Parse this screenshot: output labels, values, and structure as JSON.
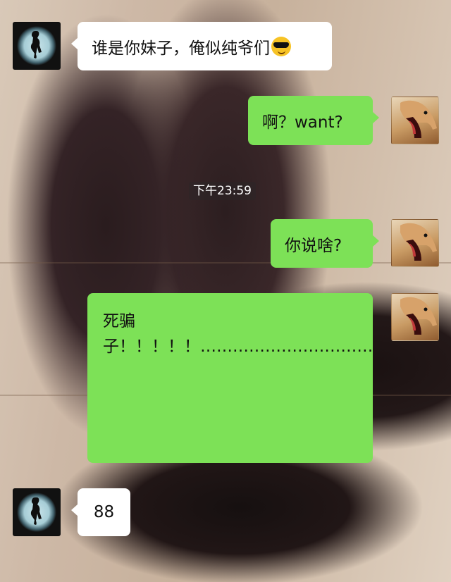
{
  "messages": [
    {
      "side": "left",
      "avatar": "silhouette-avatar",
      "text": "谁是你妹子，俺似纯爷们",
      "emoji": "cool-sunglasses-emoji"
    },
    {
      "side": "right",
      "avatar": "dog-avatar",
      "text": "啊？want?"
    },
    {
      "side": "right",
      "avatar": "dog-avatar",
      "text": "你说啥?"
    },
    {
      "side": "right",
      "avatar": "dog-avatar",
      "text": "死骗子！！！！！…………………………………………………………………………………………………………………………………………………………………………………………………………"
    },
    {
      "side": "left",
      "avatar": "silhouette-avatar",
      "text": "88"
    }
  ],
  "timestamp": "下午23:59",
  "colors": {
    "outgoing_bubble": "#7de157",
    "incoming_bubble": "#ffffff",
    "timestamp_bg": "rgba(40,40,40,0.35)"
  }
}
